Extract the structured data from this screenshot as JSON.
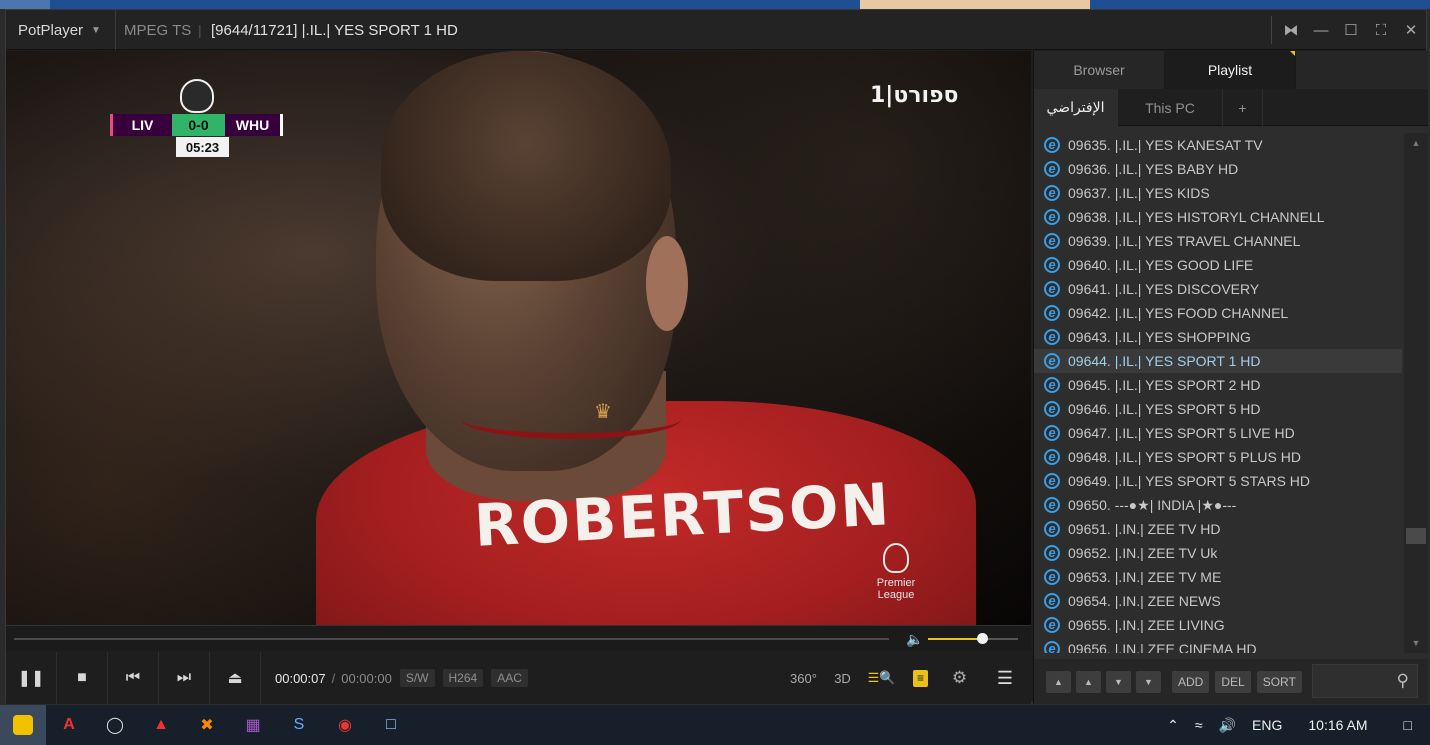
{
  "window": {
    "app_name": "PotPlayer",
    "format": "MPEG TS",
    "title_separator": "|",
    "title": "[9644/11721] |.IL.| YES SPORT 1 HD",
    "controls": [
      "⧓",
      "—",
      "☐",
      "⛶",
      "✕"
    ]
  },
  "video": {
    "channel_bug": "1|ספורט",
    "jersey_name": "ROBERTSON",
    "badge_text": "Premier League",
    "scoreboard": {
      "home": "LIV",
      "score": "0-0",
      "away": "WHU",
      "clock": "05:23"
    }
  },
  "playback": {
    "current_time": "00:00:07",
    "separator": "/",
    "total_time": "00:00:00",
    "tags": [
      "S/W",
      "H264",
      "AAC"
    ],
    "volume_level": 0.6,
    "right_icons": {
      "vr": "360°",
      "three_d": "3D"
    }
  },
  "panel": {
    "tabs": [
      "Browser",
      "Playlist"
    ],
    "subtabs": [
      "الإفتراضي",
      "This PC",
      "+"
    ],
    "selected_index": 9,
    "items": [
      "09635. |.IL.| YES KANESAT TV",
      "09636. |.IL.| YES BABY HD",
      "09637. |.IL.| YES KIDS",
      "09638. |.IL.| YES HISTORYL CHANNELL",
      "09639. |.IL.| YES TRAVEL CHANNEL",
      "09640. |.IL.| YES GOOD LIFE",
      "09641. |.IL.| YES DISCOVERY",
      "09642. |.IL.| YES FOOD CHANNEL",
      "09643. |.IL.| YES SHOPPING",
      "09644. |.IL.| YES SPORT 1 HD",
      "09645. |.IL.| YES SPORT 2 HD",
      "09646. |.IL.| YES SPORT 5 HD",
      "09647. |.IL.| YES SPORT 5 LIVE HD",
      "09648. |.IL.| YES SPORT 5 PLUS HD",
      "09649. |.IL.| YES SPORT 5 STARS HD",
      "09650. ---●★| INDIA |★●---",
      "09651. |.IN.| ZEE TV HD",
      "09652. |.IN.| ZEE TV Uk",
      "09653. |.IN.| ZEE TV ME",
      "09654. |.IN.| ZEE NEWS",
      "09655. |.IN.| ZEE LIVING",
      "09656. |.IN.| ZEE CINEMA HD"
    ],
    "buttons": {
      "add": "ADD",
      "del": "DEL",
      "sort": "SORT"
    }
  },
  "taskbar": {
    "language": "ENG",
    "clock": "10:16 AM"
  },
  "colors": {
    "accent": "#e8c21b",
    "selected_text": "#9fd0ea"
  }
}
